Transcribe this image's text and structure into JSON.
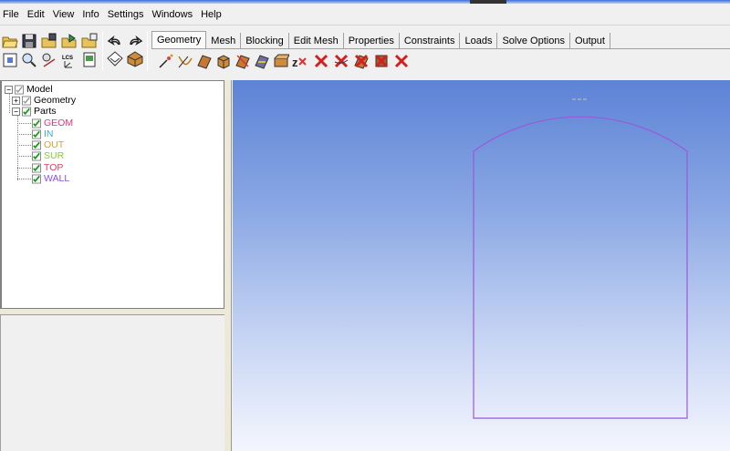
{
  "menu": [
    "File",
    "Edit",
    "View",
    "Info",
    "Settings",
    "Windows",
    "Help"
  ],
  "toolbar_left": {
    "row1": [
      "open-folder-icon",
      "save-icon",
      "load-geometry-icon",
      "save-geometry-icon",
      "export-icon",
      "undo-icon",
      "redo-icon"
    ],
    "row2": [
      "fit-window-icon",
      "zoom-icon",
      "measure-icon",
      "local-coordinate-icon",
      "report-icon",
      "shaded-view-icon",
      "solid-view-icon"
    ]
  },
  "tabs": [
    {
      "label": "Geometry",
      "active": true
    },
    {
      "label": "Mesh",
      "active": false
    },
    {
      "label": "Blocking",
      "active": false
    },
    {
      "label": "Edit Mesh",
      "active": false
    },
    {
      "label": "Properties",
      "active": false
    },
    {
      "label": "Constraints",
      "active": false
    },
    {
      "label": "Loads",
      "active": false
    },
    {
      "label": "Solve Options",
      "active": false
    },
    {
      "label": "Output",
      "active": false
    }
  ],
  "geometry_tools": [
    "create-point-icon",
    "create-curve-icon",
    "create-surface-icon",
    "create-body-icon",
    "repair-geometry-icon",
    "transform-geometry-icon",
    "restore-geometry-icon",
    "create-faceted-icon",
    "delete-point-icon",
    "delete-curve-icon",
    "delete-surface-icon",
    "delete-body-icon",
    "delete-any-icon"
  ],
  "tree": {
    "root": "Model",
    "geometry": "Geometry",
    "parts_label": "Parts",
    "parts": [
      {
        "name": "GEOM",
        "color": "#e0367a"
      },
      {
        "name": "IN",
        "color": "#2fb0d8"
      },
      {
        "name": "OUT",
        "color": "#e0a020"
      },
      {
        "name": "SUR",
        "color": "#7ed030"
      },
      {
        "name": "TOP",
        "color": "#e04060"
      },
      {
        "name": "WALL",
        "color": "#8a4fe0"
      }
    ]
  },
  "viewport": {
    "outline_color": "#9a5ad8"
  }
}
